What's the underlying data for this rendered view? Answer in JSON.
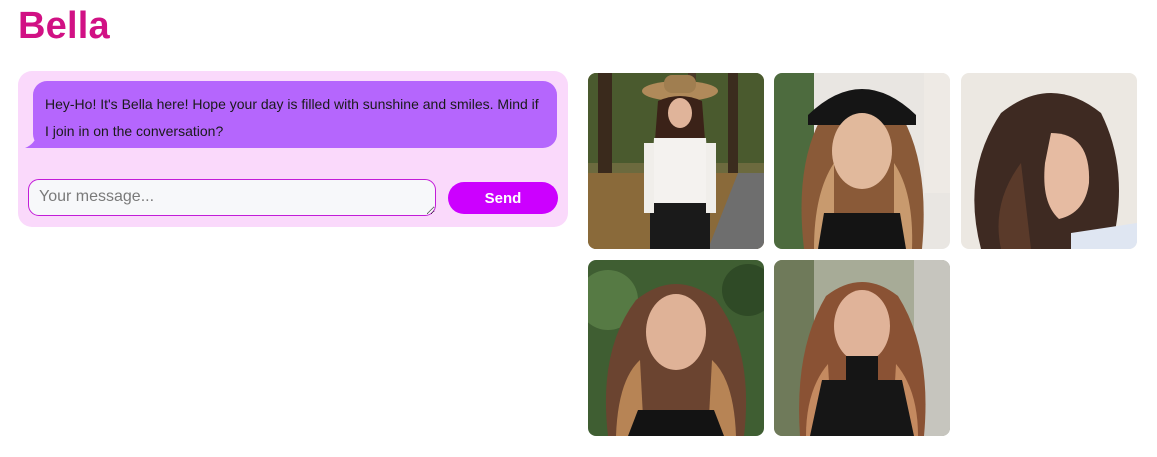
{
  "header": {
    "title": "Bella"
  },
  "chat": {
    "messages": [
      {
        "sender": "Bella",
        "text": "Hey-Ho! It's Bella here! Hope your day is filled with sunshine and smiles. Mind if I join in on the conversation?"
      }
    ],
    "input_placeholder": "Your message...",
    "input_value": "",
    "send_label": "Send"
  },
  "gallery": {
    "images": [
      {
        "subject": "woman-in-hat-park"
      },
      {
        "subject": "woman-black-beanie"
      },
      {
        "subject": "woman-profile-light-bg"
      },
      {
        "subject": "woman-green-bg"
      },
      {
        "subject": "woman-black-turtleneck"
      }
    ]
  },
  "colors": {
    "title": "#d11184",
    "panel_bg": "#fad9fb",
    "bubble_bg": "#b566fd",
    "send_bg": "#cc00ff",
    "input_border": "#c21cd8"
  }
}
